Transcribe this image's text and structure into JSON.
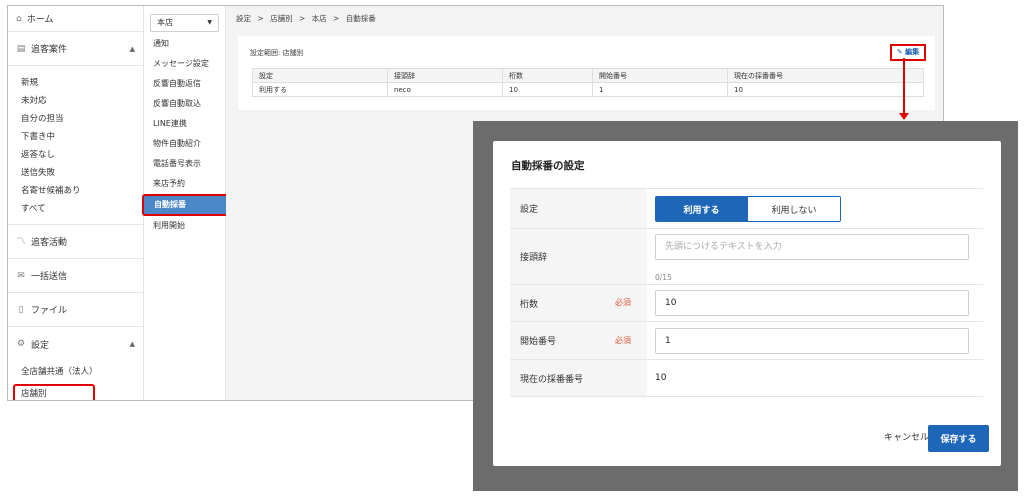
{
  "sidebar": {
    "home": "ホーム",
    "tracking": "追客案件",
    "tracking_items": [
      "新規",
      "未対応",
      "自分の担当",
      "下書き中",
      "返答なし",
      "送信失敗",
      "名寄せ候補あり",
      "すべて"
    ],
    "activity": "追客活動",
    "bulk_send": "一括送信",
    "files": "ファイル",
    "settings": "設定",
    "settings_items": [
      "全店舗共通（法人）",
      "店舗別"
    ]
  },
  "midcol": {
    "store": "本店",
    "items": [
      "通知",
      "メッセージ設定",
      "反響自動返信",
      "反響自動取込",
      "LINE連携",
      "物件自動紹介",
      "電話番号表示",
      "来店予約",
      "自動採番",
      "利用開始"
    ],
    "active_index": 8
  },
  "main": {
    "breadcrumb": [
      "設定",
      ">",
      "店舗別",
      ">",
      "本店",
      ">",
      "自動採番"
    ],
    "scope_label": "設定範囲: 店舗別",
    "edit_label": "編集",
    "table": {
      "headers": [
        "設定",
        "接頭辞",
        "桁数",
        "開始番号",
        "現在の採番番号"
      ],
      "row": [
        "利用する",
        "neco",
        "10",
        "1",
        "10"
      ]
    }
  },
  "modal": {
    "title": "自動採番の設定",
    "setting_label": "設定",
    "toggle_on": "利用する",
    "toggle_off": "利用しない",
    "prefix_label": "接頭辞",
    "prefix_placeholder": "先頭につけるテキストを入力",
    "prefix_counter": "0/15",
    "digits_label": "桁数",
    "digits_value": "10",
    "start_label": "開始番号",
    "start_value": "1",
    "required": "必須",
    "current_label": "現在の採番番号",
    "current_value": "10",
    "cancel": "キャンセル",
    "save": "保存する"
  },
  "colors": {
    "primary": "#1e66b8",
    "highlight": "#e00000",
    "required": "#e05a3a"
  }
}
